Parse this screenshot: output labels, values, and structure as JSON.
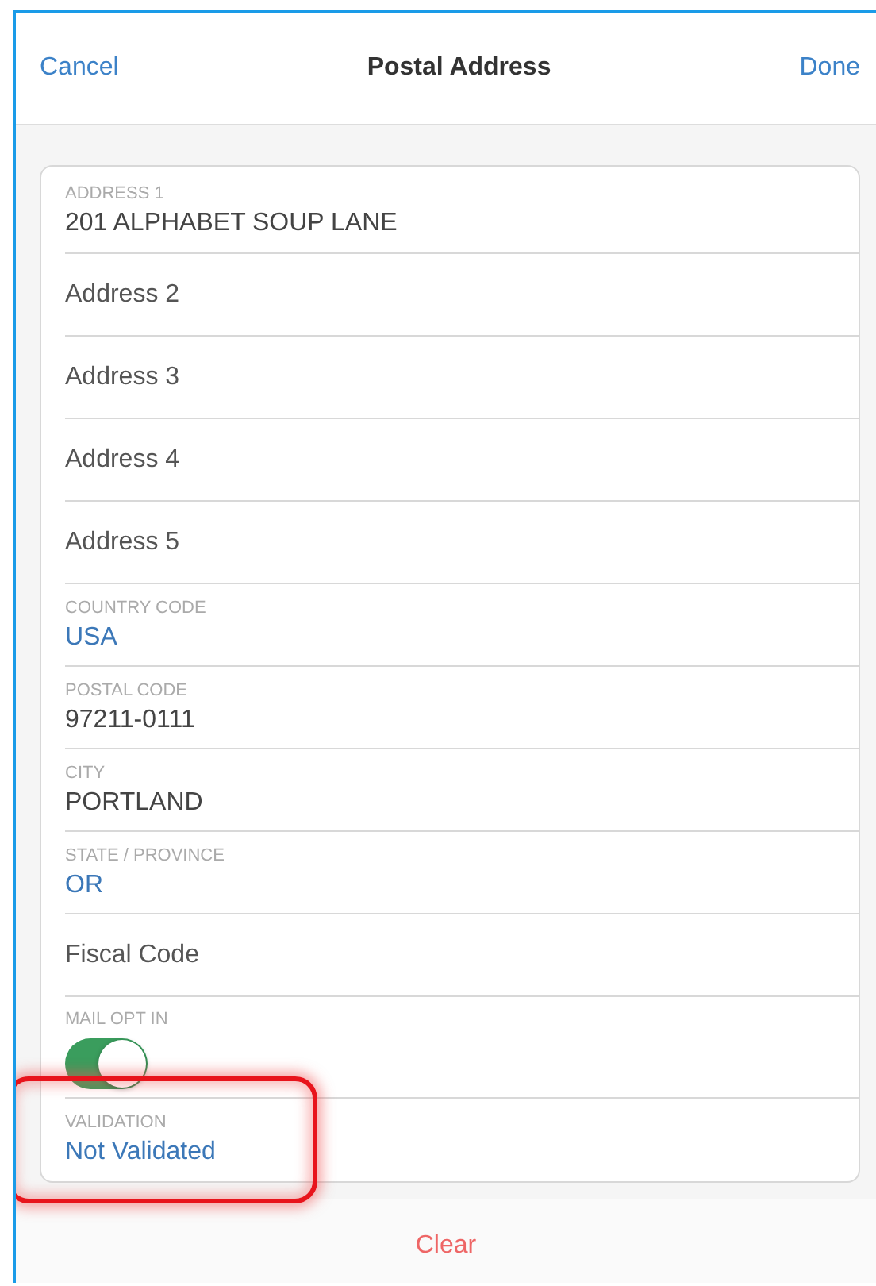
{
  "header": {
    "cancel": "Cancel",
    "title": "Postal Address",
    "done": "Done"
  },
  "fields": [
    {
      "kind": "text",
      "label": "ADDRESS 1",
      "value": "201 ALPHABET SOUP LANE",
      "highlighted": false
    },
    {
      "kind": "empty",
      "placeholder": "Address 2",
      "highlighted": false
    },
    {
      "kind": "empty",
      "placeholder": "Address 3",
      "highlighted": false
    },
    {
      "kind": "empty",
      "placeholder": "Address 4",
      "highlighted": false
    },
    {
      "kind": "empty",
      "placeholder": "Address 5",
      "highlighted": false
    },
    {
      "kind": "pick",
      "label": "COUNTRY CODE",
      "value": "USA",
      "highlighted": false
    },
    {
      "kind": "text",
      "label": "POSTAL CODE",
      "value": "97211-0111",
      "highlighted": false
    },
    {
      "kind": "text",
      "label": "CITY",
      "value": "PORTLAND",
      "highlighted": false
    },
    {
      "kind": "pick",
      "label": "STATE / PROVINCE",
      "value": "OR",
      "highlighted": false
    },
    {
      "kind": "empty",
      "placeholder": "Fiscal Code",
      "highlighted": false
    },
    {
      "kind": "toggle",
      "label": "MAIL OPT IN",
      "on": true,
      "highlighted": false
    },
    {
      "kind": "pick",
      "label": "VALIDATION",
      "value": "Not Validated",
      "highlighted": true
    }
  ],
  "footer": {
    "clear": "Clear"
  }
}
